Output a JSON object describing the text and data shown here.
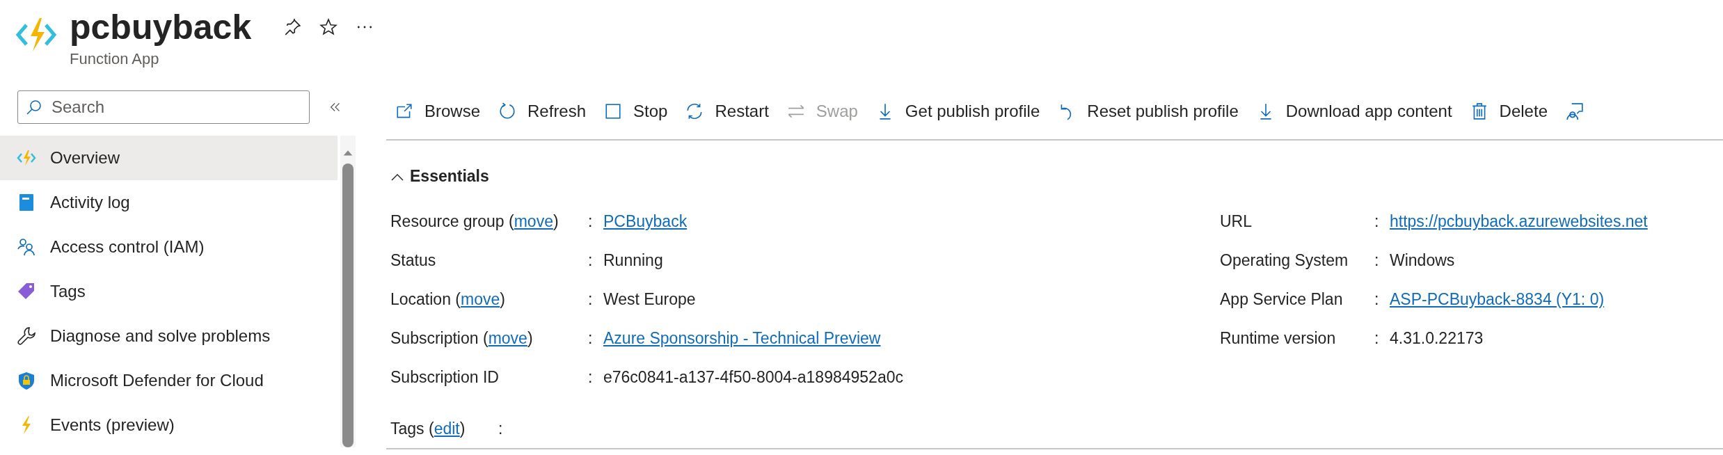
{
  "header": {
    "title": "pcbuyback",
    "subtitle": "Function App"
  },
  "sidebar": {
    "search": {
      "placeholder": "Search"
    },
    "items": [
      {
        "label": "Overview",
        "kind": "function",
        "selected": true
      },
      {
        "label": "Activity log",
        "kind": "book",
        "selected": false
      },
      {
        "label": "Access control (IAM)",
        "kind": "people",
        "selected": false
      },
      {
        "label": "Tags",
        "kind": "tag",
        "selected": false
      },
      {
        "label": "Diagnose and solve problems",
        "kind": "wrench",
        "selected": false
      },
      {
        "label": "Microsoft Defender for Cloud",
        "kind": "shield",
        "selected": false
      },
      {
        "label": "Events (preview)",
        "kind": "bolt",
        "selected": false
      }
    ]
  },
  "toolbar": [
    {
      "label": "Browse",
      "kind": "browse",
      "disabled": false
    },
    {
      "label": "Refresh",
      "kind": "refresh",
      "disabled": false
    },
    {
      "label": "Stop",
      "kind": "stop",
      "disabled": false
    },
    {
      "label": "Restart",
      "kind": "restart",
      "disabled": false
    },
    {
      "label": "Swap",
      "kind": "swap",
      "disabled": true
    },
    {
      "label": "Get publish profile",
      "kind": "download",
      "disabled": false
    },
    {
      "label": "Reset publish profile",
      "kind": "undo",
      "disabled": false
    },
    {
      "label": "Download app content",
      "kind": "download",
      "disabled": false
    },
    {
      "label": "Delete",
      "kind": "trash",
      "disabled": false
    },
    {
      "kind": "feedback"
    }
  ],
  "essentials": {
    "title": "Essentials",
    "expanded": true,
    "left": [
      {
        "label": "Resource group (",
        "label_link": "move",
        "label_after": ")",
        "separator": ":",
        "value": "PCBuyback",
        "value_is_link": true
      },
      {
        "label": "Status",
        "separator": ":",
        "value": "Running",
        "value_is_link": false
      },
      {
        "label": "Location (",
        "label_link": "move",
        "label_after": ")",
        "separator": ":",
        "value": "West Europe",
        "value_is_link": false
      },
      {
        "label": "Subscription (",
        "label_link": "move",
        "label_after": ")",
        "separator": ":",
        "value": "Azure Sponsorship - Technical Preview",
        "value_is_link": true
      },
      {
        "label": "Subscription ID",
        "separator": ":",
        "value": "e76c0841-a137-4f50-8004-a18984952a0c",
        "value_is_link": false
      }
    ],
    "right": [
      {
        "label": "URL",
        "separator": ":",
        "value": "https://pcbuyback.azurewebsites.net",
        "value_is_link": true
      },
      {
        "label": "Operating System",
        "separator": ":",
        "value": "Windows",
        "value_is_link": false
      },
      {
        "label": "App Service Plan",
        "separator": ":",
        "value": "ASP-PCBuyback-8834 (Y1: 0)",
        "value_is_link": true
      },
      {
        "label": "Runtime version",
        "separator": ":",
        "value": "4.31.0.22173",
        "value_is_link": false
      }
    ],
    "tags": {
      "label": "Tags (",
      "label_link": "edit",
      "label_after": ")",
      "separator": ":"
    }
  }
}
